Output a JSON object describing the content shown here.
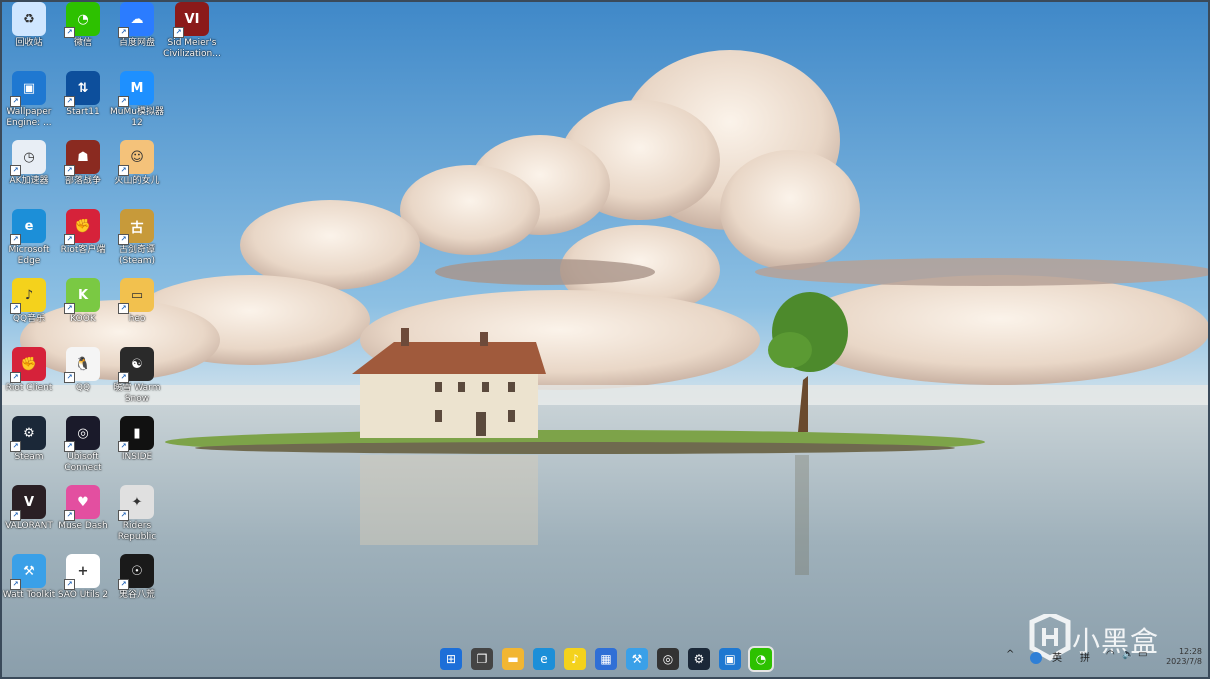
{
  "desktop": {
    "icons": [
      {
        "label": "回收站",
        "icon": "recycle-bin-icon",
        "color": "#cfe6ff",
        "glyph": "♻"
      },
      {
        "label": "微信",
        "icon": "wechat-icon",
        "color": "#2dc100",
        "glyph": "◔"
      },
      {
        "label": "百度网盘",
        "icon": "baidu-netdisk-icon",
        "color": "#2b7cff",
        "glyph": "☁"
      },
      {
        "label": "Sid Meier's Civilization...",
        "icon": "civilization-vi-icon",
        "color": "#8b1a1a",
        "glyph": "VI"
      },
      {
        "label": "Wallpaper Engine: ...",
        "icon": "wallpaper-engine-icon",
        "color": "#1f78d1",
        "glyph": "▣"
      },
      {
        "label": "Start11",
        "icon": "start11-icon",
        "color": "#0d4f9c",
        "glyph": "⇅"
      },
      {
        "label": "MuMu模拟器12",
        "icon": "mumu-emulator-icon",
        "color": "#1e90ff",
        "glyph": "M"
      },
      {
        "label": "AK加速器",
        "icon": "ak-accelerator-icon",
        "color": "#e8eef5",
        "glyph": "◷"
      },
      {
        "label": "部落战争",
        "icon": "game-warrior-icon",
        "color": "#8a2a20",
        "glyph": "☗"
      },
      {
        "label": "火山的女儿",
        "icon": "anime-girl-icon",
        "color": "#f4c27a",
        "glyph": "☺"
      },
      {
        "label": "Microsoft Edge",
        "icon": "edge-icon",
        "color": "#1c8fd8",
        "glyph": "e"
      },
      {
        "label": "Riot客户端",
        "icon": "riot-client-icon",
        "color": "#d6223a",
        "glyph": "✊"
      },
      {
        "label": "古剑奇谭(Steam)",
        "icon": "gujian-icon",
        "color": "#c79a3a",
        "glyph": "古"
      },
      {
        "label": "QQ音乐",
        "icon": "qq-music-icon",
        "color": "#f4d21c",
        "glyph": "♪"
      },
      {
        "label": "KOOK",
        "icon": "kook-icon",
        "color": "#7ac943",
        "glyph": "K"
      },
      {
        "label": "heo",
        "icon": "folder-icon",
        "color": "#f2c14e",
        "glyph": "▭"
      },
      {
        "label": "Riot Client",
        "icon": "riot-icon",
        "color": "#d6223a",
        "glyph": "✊"
      },
      {
        "label": "QQ",
        "icon": "qq-icon",
        "color": "#f5f5f5",
        "glyph": "🐧"
      },
      {
        "label": "暖雪 Warm Snow",
        "icon": "warm-snow-icon",
        "color": "#2a2a2a",
        "glyph": "☯"
      },
      {
        "label": "Steam",
        "icon": "steam-icon",
        "color": "#1b2838",
        "glyph": "⚙"
      },
      {
        "label": "Ubisoft Connect",
        "icon": "ubisoft-connect-icon",
        "color": "#1a1a2a",
        "glyph": "◎"
      },
      {
        "label": "INSIDE",
        "icon": "inside-icon",
        "color": "#111111",
        "glyph": "▮"
      },
      {
        "label": "VALORANT",
        "icon": "valorant-icon",
        "color": "#2a1f24",
        "glyph": "V"
      },
      {
        "label": "Muse Dash",
        "icon": "muse-dash-icon",
        "color": "#e34fa0",
        "glyph": "♥"
      },
      {
        "label": "Riders Republic",
        "icon": "riders-republic-icon",
        "color": "#e0e0e0",
        "glyph": "✦"
      },
      {
        "label": "Watt Toolkit",
        "icon": "watt-toolkit-icon",
        "color": "#3aa0e8",
        "glyph": "⚒"
      },
      {
        "label": "SAO Utils 2",
        "icon": "sao-utils-icon",
        "color": "#ffffff",
        "glyph": "+"
      },
      {
        "label": "鬼谷八荒",
        "icon": "game-mask-icon",
        "color": "#1a1a1a",
        "glyph": "☉"
      }
    ]
  },
  "taskbar": {
    "apps": [
      {
        "name": "start-button",
        "icon": "windows-start-icon",
        "color": "#1d6fd8",
        "glyph": "⊞"
      },
      {
        "name": "task-view",
        "icon": "task-view-icon",
        "color": "#444444",
        "glyph": "❐"
      },
      {
        "name": "file-explorer",
        "icon": "folder-icon",
        "color": "#f2b632",
        "glyph": "▬"
      },
      {
        "name": "edge",
        "icon": "edge-icon",
        "color": "#1c8fd8",
        "glyph": "e"
      },
      {
        "name": "qq-music",
        "icon": "qq-music-icon",
        "color": "#f4d21c",
        "glyph": "♪"
      },
      {
        "name": "microsoft-store",
        "icon": "store-icon",
        "color": "#2f6fd6",
        "glyph": "▦"
      },
      {
        "name": "watt-toolkit",
        "icon": "watt-toolkit-icon",
        "color": "#3aa0e8",
        "glyph": "⚒"
      },
      {
        "name": "ubisoft-connect",
        "icon": "ubisoft-connect-icon",
        "color": "#333333",
        "glyph": "◎"
      },
      {
        "name": "steam",
        "icon": "steam-icon",
        "color": "#1b2838",
        "glyph": "⚙"
      },
      {
        "name": "wallpaper-engine",
        "icon": "wallpaper-engine-icon",
        "color": "#1f78d1",
        "glyph": "▣"
      },
      {
        "name": "wechat",
        "icon": "wechat-icon",
        "color": "#2dc100",
        "glyph": "◔"
      }
    ],
    "tray": {
      "chevron": "^",
      "lang": "英",
      "ime": "拼",
      "time": "12:28",
      "date": "2023/7/8"
    }
  },
  "watermark": {
    "text": "小黑盒"
  },
  "colors": {
    "sky_top": "#4f95cf",
    "sky_bottom": "#cfe3ef",
    "water": "#a9b9c2",
    "grass": "#6d9a3a"
  }
}
